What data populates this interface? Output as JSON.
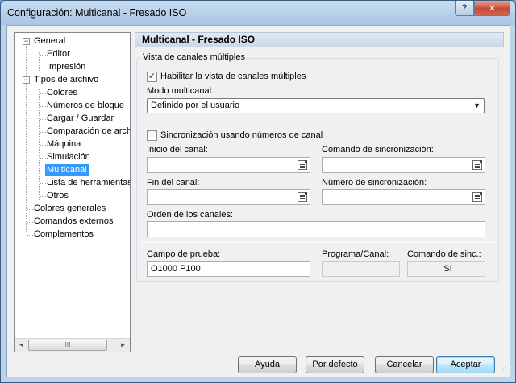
{
  "window": {
    "title": "Configuración: Multicanal - Fresado ISO",
    "help_glyph": "?",
    "close_glyph": "✕"
  },
  "tree": {
    "items": [
      {
        "label": "General",
        "expander": "−"
      },
      {
        "label": "Editor"
      },
      {
        "label": "Impresión"
      },
      {
        "label": "Tipos de archivo",
        "expander": "−"
      },
      {
        "label": "Colores"
      },
      {
        "label": "Números de bloque"
      },
      {
        "label": "Cargar / Guardar"
      },
      {
        "label": "Comparación de archivos"
      },
      {
        "label": "Máquina"
      },
      {
        "label": "Simulación"
      },
      {
        "label": "Multicanal",
        "selected": true
      },
      {
        "label": "Lista de herramientas"
      },
      {
        "label": "Otros"
      },
      {
        "label": "Colores generales"
      },
      {
        "label": "Comandos externos"
      },
      {
        "label": "Complementos"
      }
    ],
    "scroll_left": "◄",
    "scroll_right": "►",
    "thumb_grip": "III"
  },
  "panel": {
    "header": "Multicanal - Fresado ISO",
    "group_title": "Vista de canales múltiples",
    "enable_checkbox": {
      "label": "Habilitar la vista de canales múltiples",
      "checked": true,
      "mark": "✓"
    },
    "mode_label": "Modo multicanal:",
    "mode_value": "Definido por el usuario",
    "mode_arrow": "▼",
    "sync_checkbox": {
      "label": "Sincronización usando números de canal",
      "checked": false
    },
    "channel_start_label": "Inicio del canal:",
    "sync_command_label": "Comando de sincronización:",
    "channel_end_label": "Fin del canal:",
    "sync_number_label": "Número de sincronización:",
    "channel_order_label": "Orden de los canales:",
    "test_field_label": "Campo de prueba:",
    "test_field_value": "O1000 P100",
    "program_channel_label": "Programa/Canal:",
    "sync_cmd_result_label": "Comando de sinc.:",
    "sync_cmd_result_value": "Sí"
  },
  "buttons": {
    "help": "Ayuda",
    "default": "Por defecto",
    "cancel": "Cancelar",
    "accept": "Aceptar"
  }
}
